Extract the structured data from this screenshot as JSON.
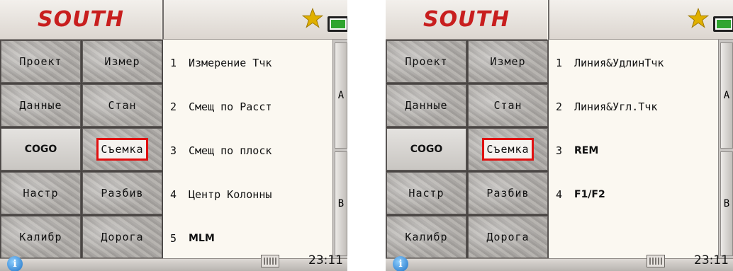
{
  "brand": "SOUTH",
  "status": {
    "time": "23:11",
    "star_color": "#e0b000",
    "battery_color": "#2fa52f"
  },
  "menu": {
    "items": [
      {
        "label": "Проект"
      },
      {
        "label": "Измер"
      },
      {
        "label": "Данные"
      },
      {
        "label": "Стан"
      },
      {
        "label": "COGO"
      },
      {
        "label": "Съемка"
      },
      {
        "label": "Настр"
      },
      {
        "label": "Разбив"
      },
      {
        "label": "Калибр"
      },
      {
        "label": "Дорога"
      }
    ],
    "selected": "Съемка",
    "selected_color": "#e01010"
  },
  "left_screen": {
    "list": [
      {
        "num": "1",
        "label": "Измерение Тчк"
      },
      {
        "num": "2",
        "label": "Смещ по Расст"
      },
      {
        "num": "3",
        "label": "Смещ по плоск"
      },
      {
        "num": "4",
        "label": "Центр Колонны"
      },
      {
        "num": "5",
        "label": "MLM"
      }
    ],
    "scroll": {
      "a": "A",
      "b": "B"
    }
  },
  "right_screen": {
    "list": [
      {
        "num": "1",
        "label": "Линия&УдлинТчк"
      },
      {
        "num": "2",
        "label": "Линия&Угл.Тчк"
      },
      {
        "num": "3",
        "label": "REM"
      },
      {
        "num": "4",
        "label": "F1/F2"
      }
    ],
    "scroll": {
      "a": "A",
      "b": "B"
    }
  }
}
